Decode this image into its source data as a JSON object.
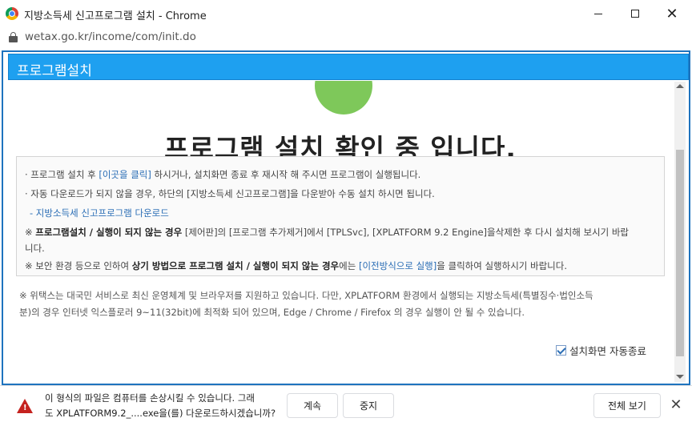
{
  "window": {
    "title": "지방소득세 신고프로그램 설치 - Chrome",
    "minimize_icon": "minimize-icon",
    "maximize_icon": "maximize-icon",
    "close_glyph": "✕"
  },
  "address_bar": {
    "url": "wetax.go.kr/income/com/init.do",
    "icon": "lock-icon"
  },
  "header": {
    "title": "프로그램설치",
    "color": "#1ea0f0"
  },
  "main": {
    "heading": "프로그램 설치 확인 중 입니다.",
    "info": {
      "line1_prefix": "· 프로그램 설치 후 ",
      "line1_link": "[이곳을 클릭]",
      "line1_suffix": " 하시거나, 설치화면 종료 후 재시작 해 주시면 프로그램이 실행됩니다.",
      "line2": "· 자동 다운로드가 되지 않을 경우, 하단의 [지방소득세 신고프로그램]을 다운받아 수동 설치 하시면 됩니다.",
      "line3_link": "- 지방소득세 신고프로그램 다운로드",
      "line4_mark": "※ ",
      "line4_bold": "프로그램설치 / 실행이 되지 않는 경우",
      "line4_suffix": " [제어판]의 [프로그램 추가제거]에서 [TPLSvc], [XPLATFORM 9.2 Engine]을삭제한 후 다시 설치해 보시기 바랍",
      "line5": "니다.",
      "line6_prefix": "※ 보안 환경 등으로 인하여 ",
      "line6_bold": "상기 방법으로 프로그램 설치 / 실행이 되지 않는 경우",
      "line6_mid": "에는 ",
      "line6_link": "[이전방식으로 실행]",
      "line6_suffix": "을 클릭하여 실행하시기 바랍니다."
    },
    "notice_line1": "※ 위택스는 대국민 서비스로 최신 운영체계 및 브라우저를 지원하고 있습니다. 다만, XPLATFORM 환경에서 실행되는 지방소득세(특별징수·법인소득",
    "notice_line2": "분)의 경우 인터넷 익스플로러 9~11(32bit)에 최적화 되어 있으며, Edge / Chrome / Firefox 의 경우 실행이 안 될 수 있습니다.",
    "auto_close_label": "설치화면 자동종료",
    "auto_close_checked": true
  },
  "download_bar": {
    "message_line1": "이 형식의 파일은 컴퓨터를 손상시킬 수 있습니다. 그래",
    "message_line2": "도 XPLATFORM9.2_....exe을(를) 다운로드하시겠습니까?",
    "continue_label": "계속",
    "stop_label": "중지",
    "show_all_label": "전체 보기",
    "close_glyph": "✕",
    "warning_color": "#c5221f"
  }
}
